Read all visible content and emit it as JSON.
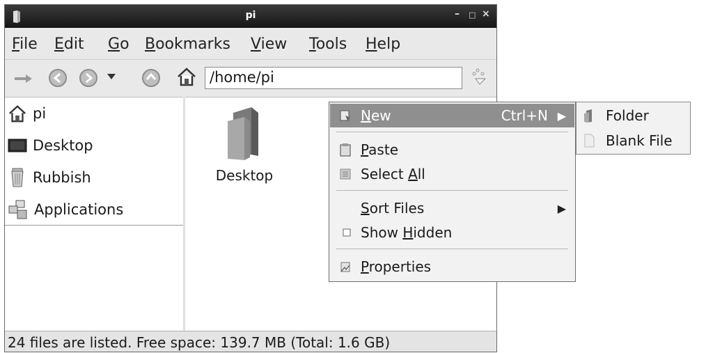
{
  "window": {
    "title": "pi",
    "min_glyph": "–",
    "max_glyph": "□",
    "close_glyph": "×"
  },
  "menubar": [
    {
      "pre": "",
      "u": "F",
      "post": "ile"
    },
    {
      "pre": "",
      "u": "E",
      "post": "dit"
    },
    {
      "pre": "",
      "u": "G",
      "post": "o"
    },
    {
      "pre": "",
      "u": "B",
      "post": "ookmarks"
    },
    {
      "pre": "",
      "u": "V",
      "post": "iew"
    },
    {
      "pre": "",
      "u": "T",
      "post": "ools"
    },
    {
      "pre": "",
      "u": "H",
      "post": "elp"
    }
  ],
  "toolbar": {
    "path": "/home/pi"
  },
  "sidebar": {
    "items": [
      {
        "label": "pi",
        "icon": "home-icon"
      },
      {
        "label": "Desktop",
        "icon": "desktop-icon"
      },
      {
        "label": "Rubbish",
        "icon": "trash-icon"
      },
      {
        "label": "Applications",
        "icon": "applications-icon"
      }
    ]
  },
  "files": [
    {
      "label": "Desktop",
      "icon": "folder-icon"
    }
  ],
  "status": "24 files are listed. Free space: 139.7 MB (Total: 1.6 GB)",
  "context_menu": {
    "new": {
      "pre": "",
      "u": "N",
      "post": "ew",
      "accel": "Ctrl+N"
    },
    "paste": {
      "pre": "",
      "u": "P",
      "post": "aste"
    },
    "select_all": {
      "pre": "Select ",
      "u": "A",
      "post": "ll"
    },
    "sort_files": {
      "pre": "",
      "u": "S",
      "post": "ort Files"
    },
    "show_hidden": {
      "pre": "Show ",
      "u": "H",
      "post": "idden"
    },
    "properties": {
      "pre": "",
      "u": "P",
      "post": "roperties"
    }
  },
  "submenu": {
    "items": [
      {
        "label": "Folder"
      },
      {
        "label": "Blank File"
      }
    ]
  },
  "colors": {
    "titlebar": "#1e1e1e",
    "highlight": "#8f8f8f",
    "menu_bg": "#f2f2f2"
  }
}
